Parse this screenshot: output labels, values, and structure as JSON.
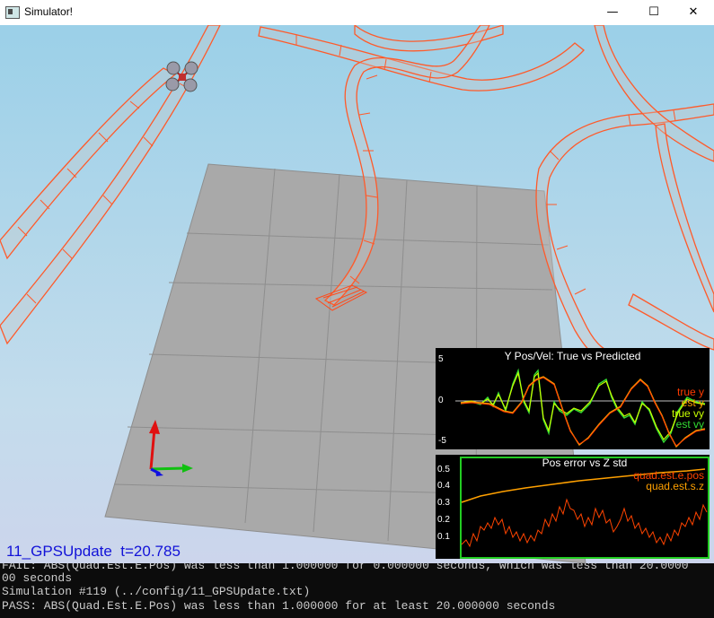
{
  "window": {
    "title": "Simulator!",
    "minimize_glyph": "—",
    "maximize_glyph": "☐",
    "close_glyph": "✕"
  },
  "viewport": {
    "scenario_label": "11_GPSUpdate  t=20.785"
  },
  "plot_top": {
    "title": "Y Pos/Vel: True vs Predicted",
    "legend": [
      {
        "label": "true y",
        "color": "#ff3b00"
      },
      {
        "label": "est y",
        "color": "#ffa000"
      },
      {
        "label": "true vy",
        "color": "#c8ff00"
      },
      {
        "label": "est vy",
        "color": "#33dd33"
      }
    ],
    "y_ticks": [
      "5",
      "0",
      "-5"
    ]
  },
  "plot_bottom": {
    "title": "Pos error vs Z std",
    "legend": [
      {
        "label": "quad.est.e.pos",
        "color": "#ff4400"
      },
      {
        "label": "quad.est.s.z",
        "color": "#ffa000"
      }
    ],
    "y_ticks": [
      "0.5",
      "0.4",
      "0.3",
      "0.2",
      "0.1"
    ],
    "border_color": "#22cc22"
  },
  "console": {
    "lines": [
      "FAIL: ABS(Quad.Est.E.Pos) was less than 1.000000 for 0.000000 seconds, which was less than 20.0000",
      "00 seconds",
      "Simulation #119 (../config/11_GPSUpdate.txt)",
      "PASS: ABS(Quad.Est.E.Pos) was less than 1.000000 for at least 20.000000 seconds"
    ]
  },
  "colors": {
    "ribbon": "#ff5a2a",
    "ground": "#a8a8a8"
  }
}
